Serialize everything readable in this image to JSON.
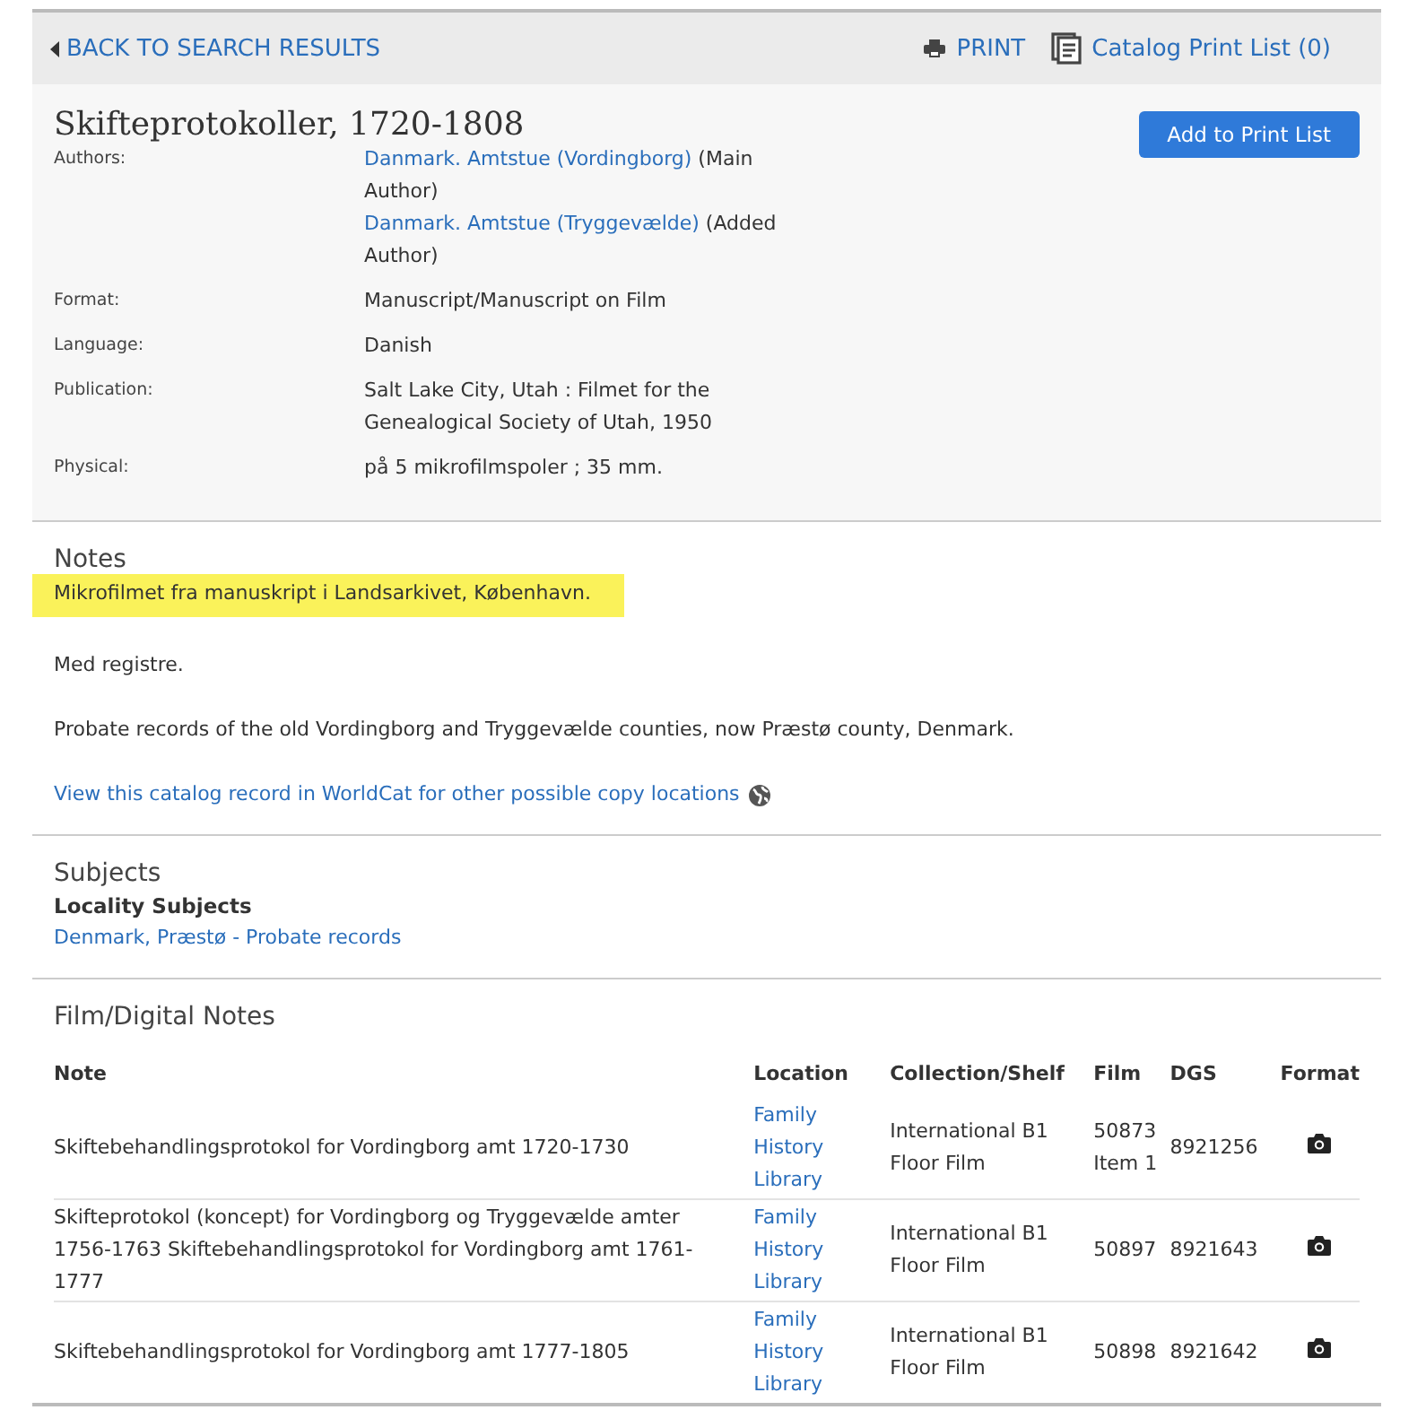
{
  "nav": {
    "back": "BACK TO SEARCH RESULTS",
    "print": "PRINT",
    "print_list": "Catalog Print List (0)"
  },
  "record": {
    "title": "Skifteprotokoller, 1720-1808",
    "add_button": "Add to Print List",
    "authors_label": "Authors:",
    "authors": [
      {
        "name": "Danmark. Amtstue (Vordingborg)",
        "role": "(Main Author)"
      },
      {
        "name": "Danmark. Amtstue (Tryggevælde)",
        "role": "(Added Author)"
      }
    ],
    "fields": [
      {
        "label": "Format:",
        "value": "Manuscript/Manuscript on Film"
      },
      {
        "label": "Language:",
        "value": "Danish"
      },
      {
        "label": "Publication:",
        "value": "Salt Lake City, Utah : Filmet for the Genealogical Society of Utah, 1950"
      },
      {
        "label": "Physical:",
        "value": "på 5 mikrofilmspoler ; 35 mm."
      }
    ]
  },
  "notes": {
    "heading": "Notes",
    "items": [
      {
        "text": "Mikrofilmet fra manuskript i Landsarkivet, København.",
        "highlighted": true
      },
      {
        "text": "Med registre.",
        "highlighted": false
      },
      {
        "text": "Probate records of the old Vordingborg and Tryggevælde counties, now Præstø county, Denmark.",
        "highlighted": false
      }
    ],
    "worldcat_link": "View this catalog record in WorldCat for other possible copy locations"
  },
  "subjects": {
    "heading": "Subjects",
    "subheading": "Locality Subjects",
    "items": [
      "Denmark, Præstø - Probate records"
    ]
  },
  "film_notes": {
    "heading": "Film/Digital Notes",
    "columns": [
      "Note",
      "Location",
      "Collection/Shelf",
      "Film",
      "DGS",
      "Format"
    ],
    "rows": [
      {
        "note": "Skiftebehandlingsprotokol for Vordingborg amt 1720-1730",
        "location": "Family History Library",
        "shelf": "International B1 Floor Film",
        "film": "50873 Item 1",
        "dgs": "8921256"
      },
      {
        "note": "Skifteprotokol (koncept) for Vordingborg og Tryggevælde amter 1756-1763 Skiftebehandlingsprotokol for Vordingborg amt 1761-1777",
        "location": "Family History Library",
        "shelf": "International B1 Floor Film",
        "film": "50897",
        "dgs": "8921643"
      },
      {
        "note": "Skiftebehandlingsprotokol for Vordingborg amt 1777-1805",
        "location": "Family History Library",
        "shelf": "International B1 Floor Film",
        "film": "50898",
        "dgs": "8921642"
      }
    ]
  }
}
